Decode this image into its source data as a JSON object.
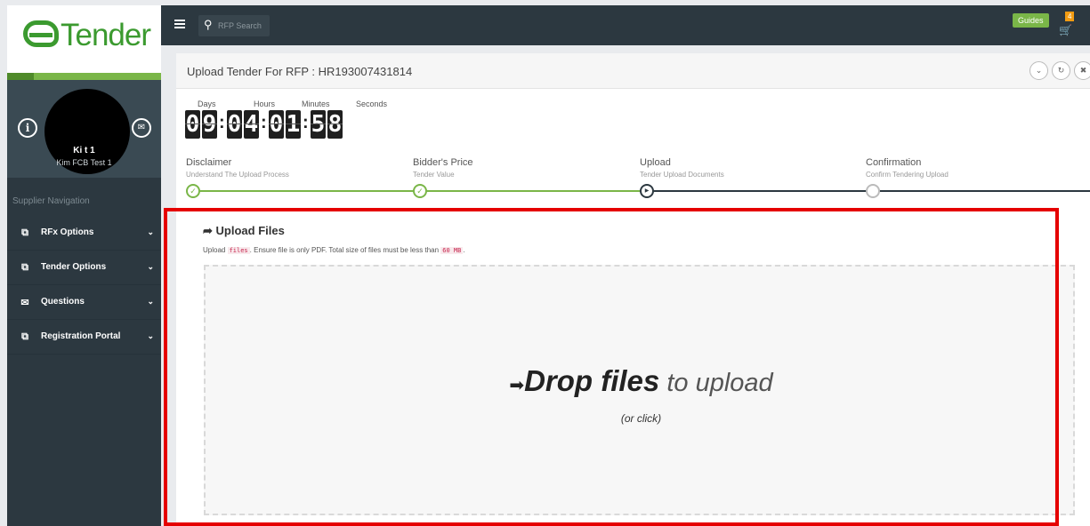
{
  "sidebar": {
    "logo_text": "Tender",
    "profile": {
      "name": "Ki              t 1",
      "sub": "Kim FCB Test 1"
    },
    "nav_header": "Supplier Navigation",
    "items": [
      {
        "label": "RFx Options",
        "icon": "clipboard-icon"
      },
      {
        "label": "Tender Options",
        "icon": "clipboard-icon"
      },
      {
        "label": "Questions",
        "icon": "envelope-icon"
      },
      {
        "label": "Registration Portal",
        "icon": "clipboard-icon"
      }
    ]
  },
  "topbar": {
    "search_placeholder": "RFP Search",
    "guides_label": "Guides",
    "cart_count": "4"
  },
  "panel": {
    "title": "Upload Tender For RFP : HR193007431814"
  },
  "countdown": {
    "labels": {
      "days": "Days",
      "hours": "Hours",
      "minutes": "Minutes",
      "seconds": "Seconds"
    },
    "digits": [
      "0",
      "9",
      "0",
      "4",
      "0",
      "1",
      "5",
      "8"
    ]
  },
  "steps": [
    {
      "title": "Disclaimer",
      "sub": "Understand The Upload Process",
      "state": "done"
    },
    {
      "title": "Bidder's Price",
      "sub": "Tender Value",
      "state": "done"
    },
    {
      "title": "Upload",
      "sub": "Tender Upload Documents",
      "state": "active"
    },
    {
      "title": "Confirmation",
      "sub": "Confirm Tendering Upload",
      "state": "todo"
    }
  ],
  "upload": {
    "title": "Upload Files",
    "desc_pre": "Upload ",
    "desc_code1": "files",
    "desc_mid": ". Ensure file is only PDF. Total size of files must be less than ",
    "desc_code2": "60 MB",
    "desc_post": ".",
    "drop_big": "Drop files",
    "drop_small": " to upload",
    "drop_sub": "(or click)"
  },
  "colors": {
    "brand_green": "#7ab648",
    "sidebar_bg": "#2c3840",
    "highlight_red": "#e50000"
  }
}
